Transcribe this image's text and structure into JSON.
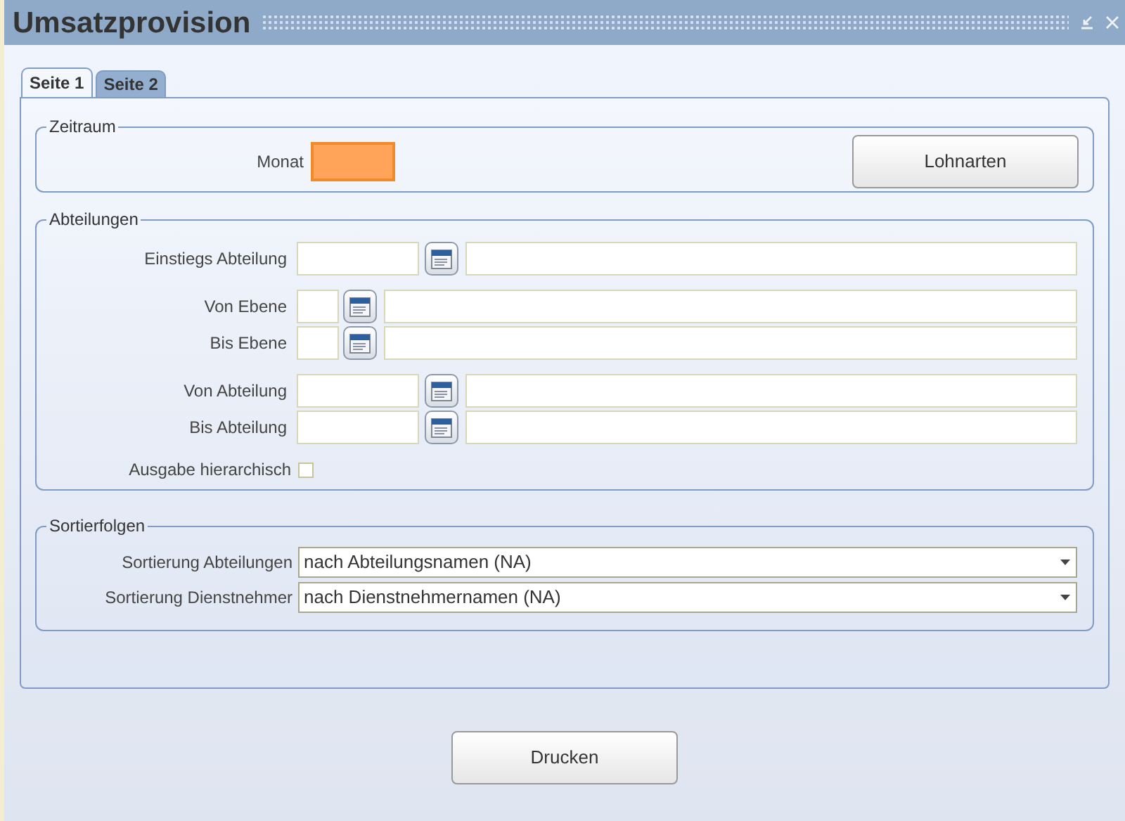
{
  "window": {
    "title": "Umsatzprovision"
  },
  "tabs": [
    {
      "label": "Seite 1",
      "selected": true
    },
    {
      "label": "Seite 2",
      "selected": false
    }
  ],
  "zeitraum": {
    "legend": "Zeitraum",
    "monat": {
      "label": "Monat",
      "focused": true
    },
    "button": "Lohnarten"
  },
  "abteilungen": {
    "legend": "Abteilungen",
    "row_groups": [
      [
        {
          "label": "Einstiegs Abteilung",
          "kind": "wide"
        }
      ],
      [
        {
          "label": "Von Ebene",
          "kind": "narrow"
        },
        {
          "label": "Bis Ebene",
          "kind": "narrow"
        }
      ],
      [
        {
          "label": "Von Abteilung",
          "kind": "wide"
        },
        {
          "label": "Bis Abteilung",
          "kind": "wide"
        }
      ]
    ],
    "checkbox": {
      "label": "Ausgabe hierarchisch",
      "checked": false
    }
  },
  "sortierfolgen": {
    "legend": "Sortierfolgen",
    "rows": [
      {
        "label": "Sortierung Abteilungen",
        "value": "nach Abteilungsnamen (NA)"
      },
      {
        "label": "Sortierung Dienstnehmer",
        "value": "nach Dienstnehmernamen (NA)"
      }
    ]
  },
  "print_button": "Drucken"
}
